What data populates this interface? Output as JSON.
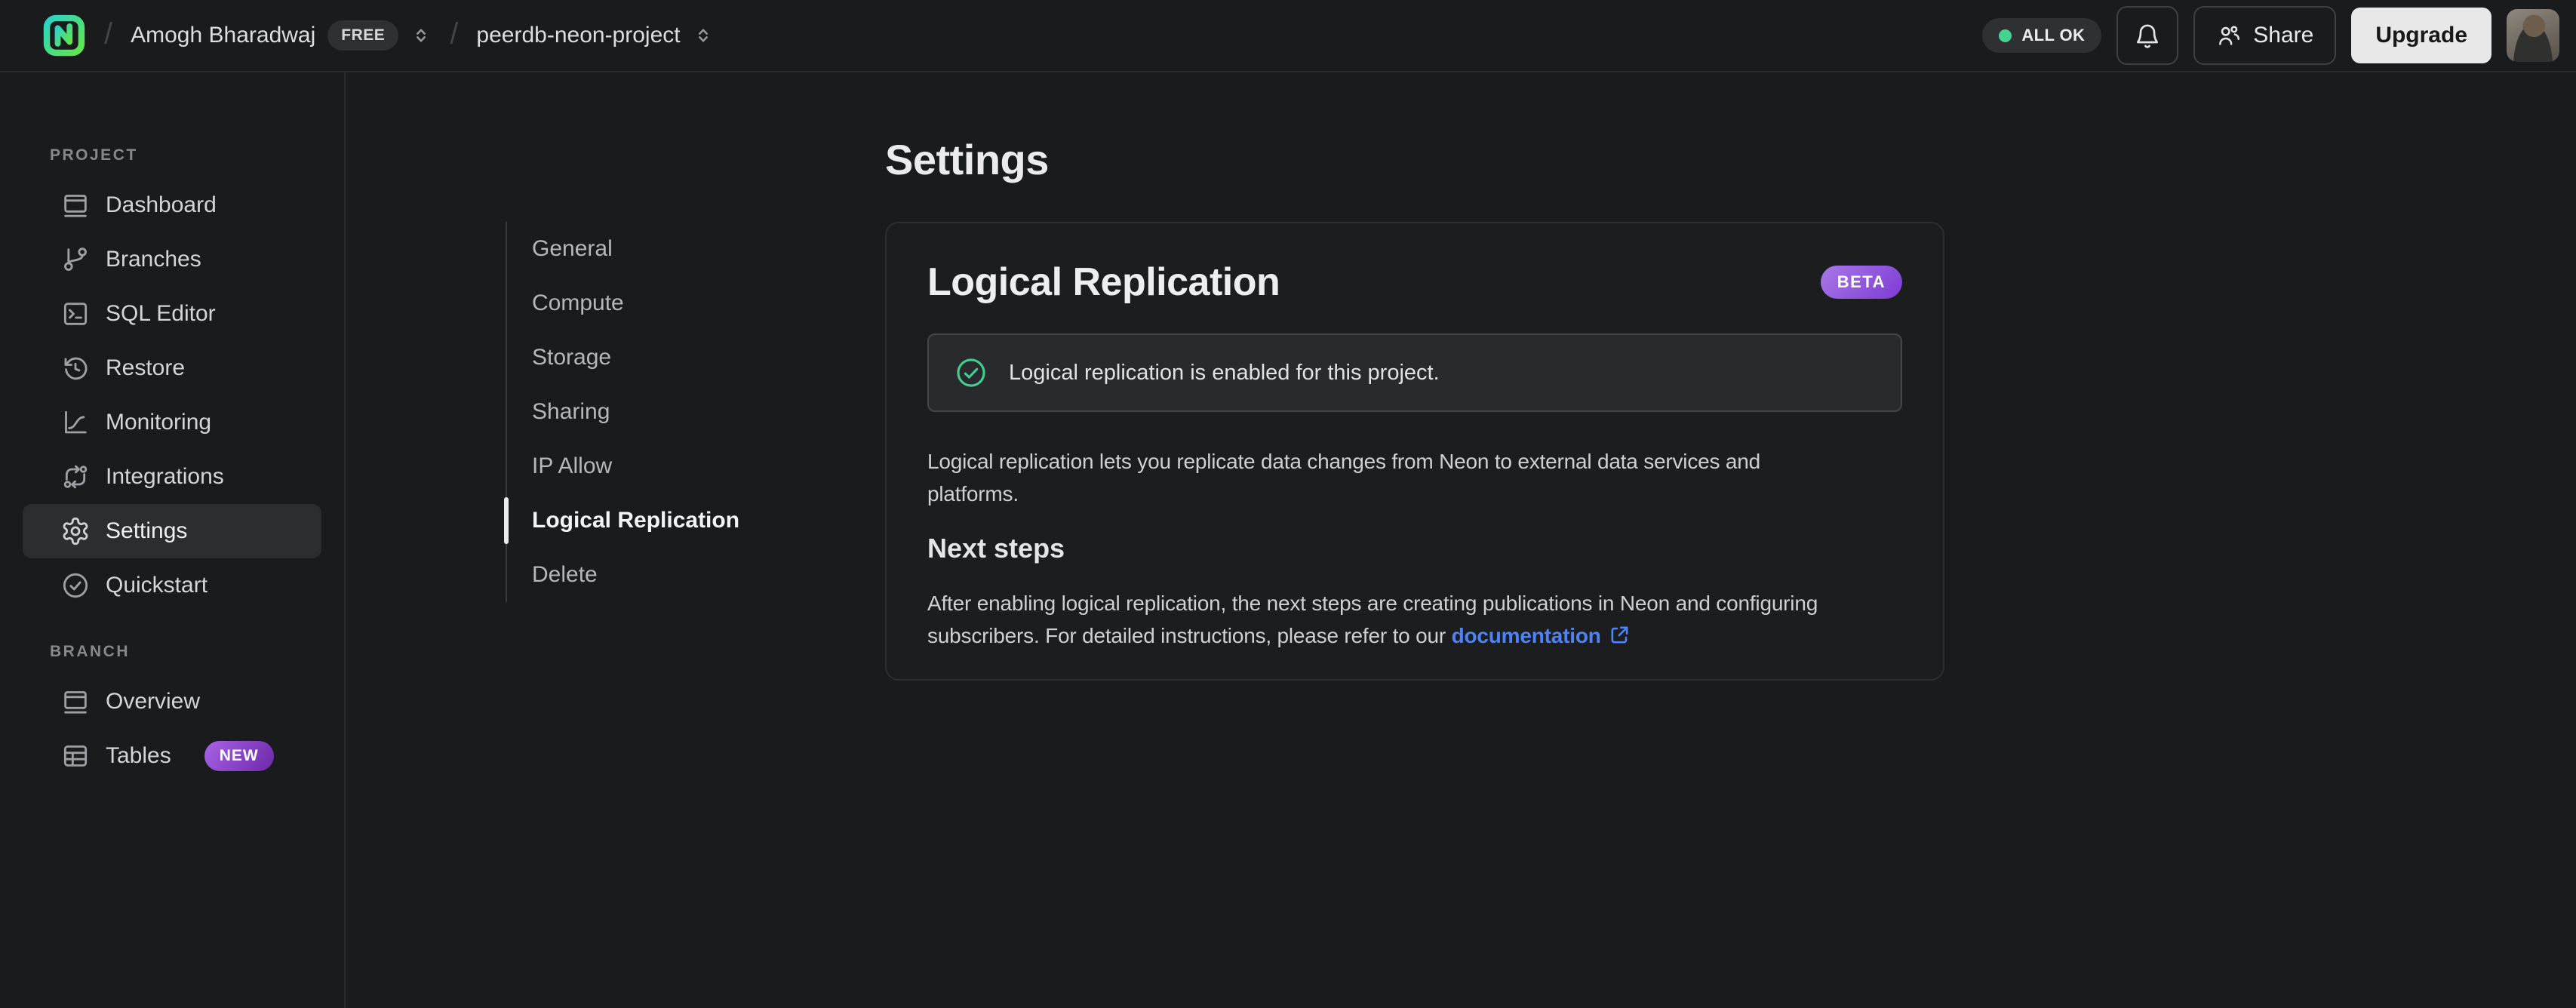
{
  "topbar": {
    "separator": "/",
    "org_name": "Amogh Bharadwaj",
    "org_plan_badge": "FREE",
    "project_name": "peerdb-neon-project",
    "status_badge": "ALL OK",
    "share_label": "Share",
    "upgrade_label": "Upgrade"
  },
  "sidebar": {
    "project_section_label": "PROJECT",
    "branch_section_label": "BRANCH",
    "project_items": [
      {
        "label": "Dashboard"
      },
      {
        "label": "Branches"
      },
      {
        "label": "SQL Editor"
      },
      {
        "label": "Restore"
      },
      {
        "label": "Monitoring"
      },
      {
        "label": "Integrations"
      },
      {
        "label": "Settings"
      },
      {
        "label": "Quickstart"
      }
    ],
    "branch_items": [
      {
        "label": "Overview"
      },
      {
        "label": "Tables",
        "badge": "NEW"
      }
    ]
  },
  "settings": {
    "page_title": "Settings",
    "nav_items": [
      {
        "label": "General"
      },
      {
        "label": "Compute"
      },
      {
        "label": "Storage"
      },
      {
        "label": "Sharing"
      },
      {
        "label": "IP Allow"
      },
      {
        "label": "Logical Replication"
      },
      {
        "label": "Delete"
      }
    ],
    "active_nav": "Logical Replication",
    "card": {
      "title": "Logical Replication",
      "beta_badge": "BETA",
      "status_message": "Logical replication is enabled for this project.",
      "description_line1": "Logical replication lets you replicate data changes from Neon to external data services and",
      "description_line2": "platforms.",
      "next_steps_title": "Next steps",
      "next_steps_line1": "After enabling logical replication, the next steps are creating publications in Neon and configuring",
      "next_steps_line2_prefix": "subscribers. For detailed instructions, please refer to our ",
      "doc_link_label": "documentation"
    }
  },
  "colors": {
    "brand_green": "#3fd08f",
    "badge_purple": "#8b4fd9",
    "link_blue": "#4f82f7",
    "status_dot_green": "#43d492"
  }
}
